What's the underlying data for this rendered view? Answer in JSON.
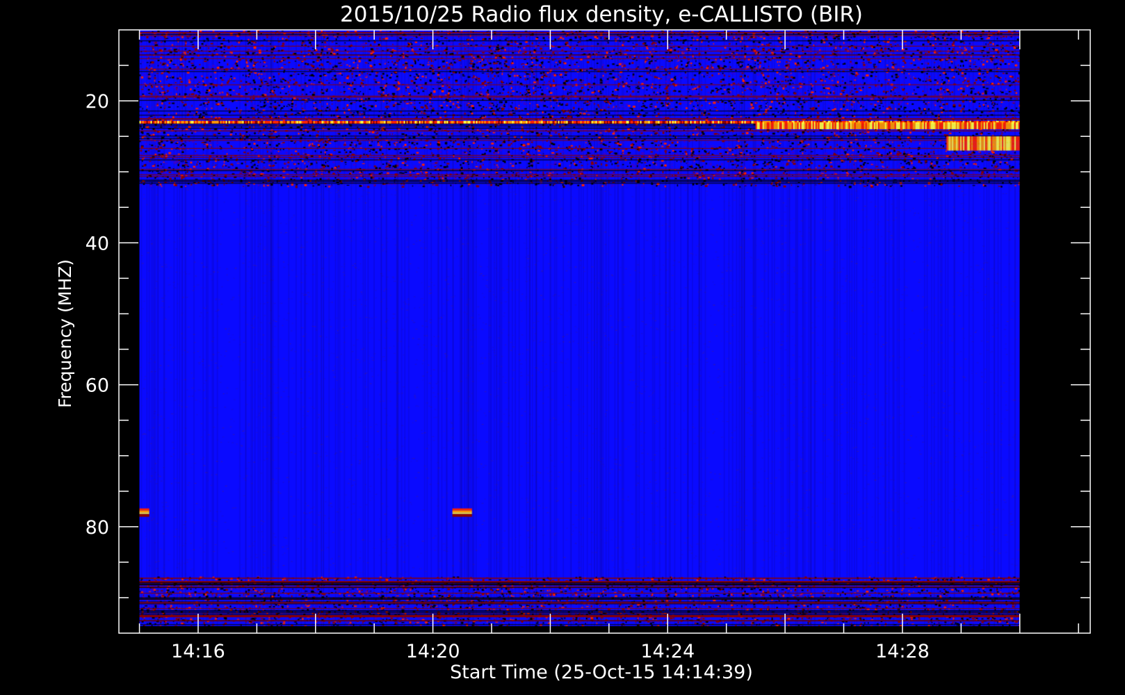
{
  "chart_data": {
    "type": "heatmap",
    "title": "2015/10/25  Radio flux density, e-CALLISTO (BIR)",
    "xlabel": "Start Time (25-Oct-15 14:14:39)",
    "ylabel": "Frequency (MHZ)",
    "xlim": [
      "14:14:39",
      "14:31:12"
    ],
    "ylim": [
      95,
      10
    ],
    "y_inverted": true,
    "data_x_range": [
      "14:15:00",
      "14:30:00"
    ],
    "data_y_range": [
      10,
      94
    ],
    "x_ticks": [
      "14:16",
      "14:20",
      "14:24",
      "14:28"
    ],
    "y_ticks": [
      20,
      40,
      60,
      80
    ],
    "grid": false,
    "colormap": [
      "#000000",
      "#0000ff",
      "#3a00cc",
      "#8a0000",
      "#ff2200",
      "#ff9900",
      "#ffff44"
    ],
    "background_color": "#0a0aff",
    "features": [
      {
        "kind": "noisy band",
        "y_range": [
          10,
          32
        ],
        "x_range": [
          "14:15:00",
          "14:30:00"
        ]
      },
      {
        "kind": "interference line",
        "y": 23,
        "x_range": [
          "14:15:00",
          "14:30:00"
        ]
      },
      {
        "kind": "intense emission",
        "y_range": [
          23,
          24
        ],
        "x_range": [
          "14:25:30",
          "14:30:00"
        ]
      },
      {
        "kind": "intense emission",
        "y_range": [
          25,
          27
        ],
        "x_range": [
          "14:28:45",
          "14:30:00"
        ]
      },
      {
        "kind": "spike",
        "y": 78,
        "x_range": [
          "14:15:00",
          "14:15:10"
        ]
      },
      {
        "kind": "spike",
        "y": 78,
        "x_range": [
          "14:20:20",
          "14:20:40"
        ]
      },
      {
        "kind": "noisy band",
        "y_range": [
          87,
          94
        ],
        "x_range": [
          "14:15:00",
          "14:30:00"
        ]
      }
    ]
  }
}
